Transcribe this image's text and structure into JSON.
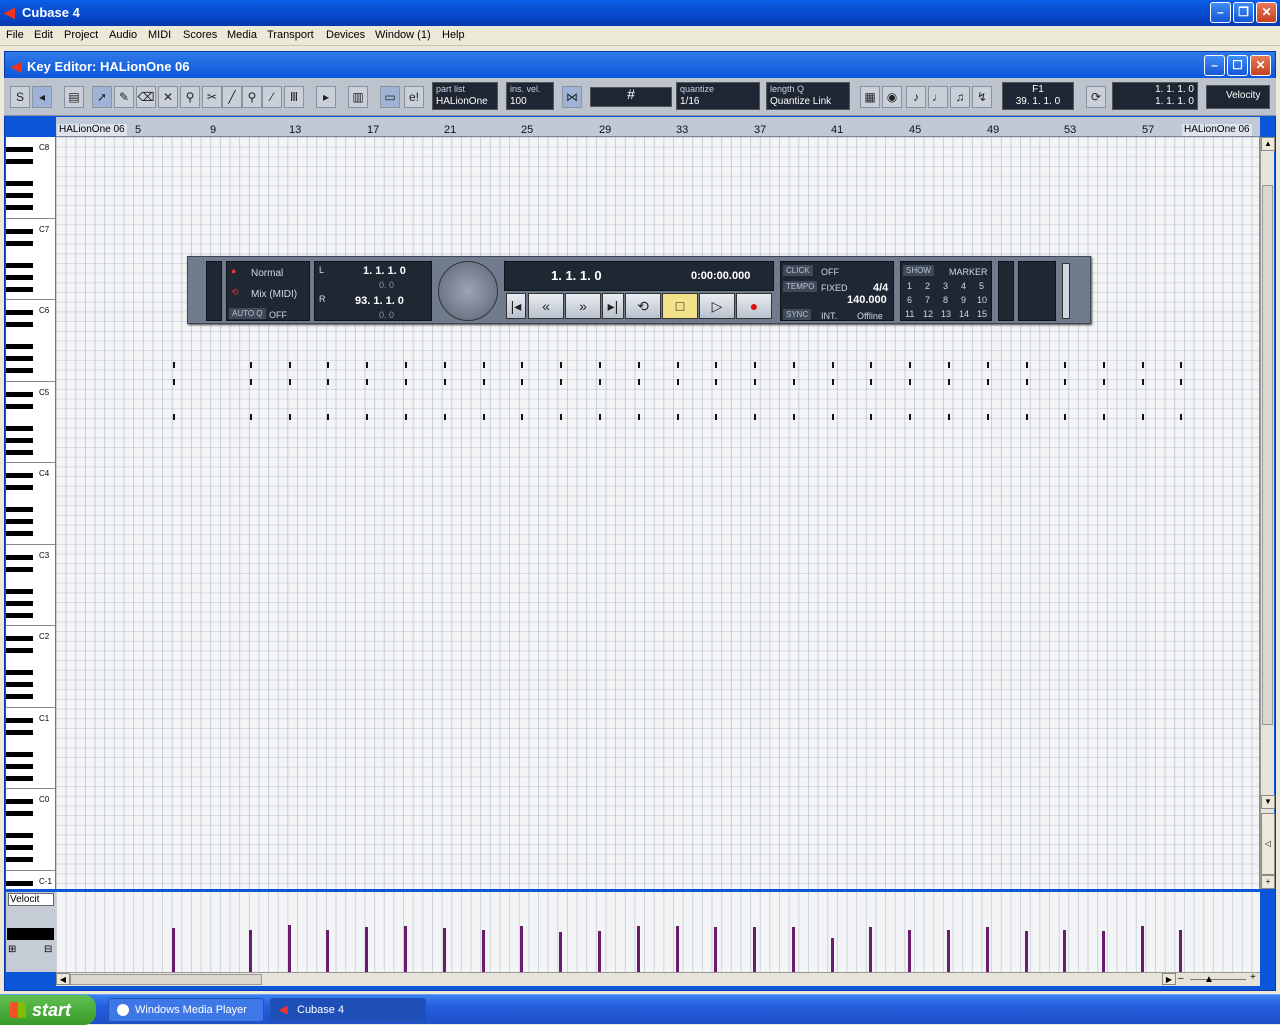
{
  "app": {
    "title": "Cubase 4"
  },
  "menu": [
    "File",
    "Edit",
    "Project",
    "Audio",
    "MIDI",
    "Scores",
    "Media",
    "Transport",
    "Devices",
    "Window (1)",
    "Help"
  ],
  "editor": {
    "title": "Key Editor: HALionOne 06"
  },
  "toolbar": {
    "part_list_label": "part list",
    "part_list_value": "HALionOne",
    "ins_vel_label": "ins. vel.",
    "ins_vel_value": "100",
    "quantize_label": "quantize",
    "quantize_value": "1/16",
    "length_label": "length Q",
    "length_value": "Quantize Link",
    "mouse_note": "F1",
    "mouse_pos": "39. 1. 1.  0",
    "pos_a": "1. 1. 1.  0",
    "pos_b": "1. 1. 1.  0",
    "lane_type": "Velocity"
  },
  "ruler": {
    "labels": [
      "5",
      "9",
      "13",
      "17",
      "21",
      "25",
      "29",
      "33",
      "37",
      "41",
      "45",
      "49",
      "53",
      "57"
    ],
    "part_start": "HALionOne 06",
    "part_end": "HALionOne 06"
  },
  "keyboard": {
    "octaves": [
      "C8",
      "C7",
      "C6",
      "C5",
      "C4",
      "C3",
      "C2",
      "C1",
      "C0",
      "C-1"
    ]
  },
  "transport": {
    "mode": "Normal",
    "mix": "Mix (MIDI)",
    "autoq": "AUTO Q",
    "autoq_val": "OFF",
    "left_loc": "1. 1. 1.  0",
    "left_sub": "0.   0",
    "right_loc": "93. 1. 1.  0",
    "right_sub": "0.   0",
    "position": "1. 1. 1.  0",
    "time": "0:00:00.000",
    "click": "CLICK",
    "click_val": "OFF",
    "tempo": "TEMPO",
    "tempo_mode": "FIXED",
    "signature": "4/4",
    "tempo_val": "140.000",
    "sync": "SYNC",
    "sync_mode": "INT.",
    "sync_status": "Offline",
    "show": "SHOW",
    "marker": "MARKER",
    "markers": [
      "1",
      "2",
      "3",
      "4",
      "5",
      "6",
      "7",
      "8",
      "9",
      "10",
      "11",
      "12",
      "13",
      "14",
      "15"
    ]
  },
  "velocity_lane": {
    "label": "Velocit"
  },
  "notes": {
    "columns": [
      173,
      250,
      289,
      327,
      366,
      405,
      444,
      483,
      521,
      560,
      599,
      638,
      677,
      715,
      754,
      793,
      832,
      870,
      909,
      948,
      987,
      1026,
      1064,
      1103,
      1142,
      1180
    ],
    "velocities": [
      0.55,
      0.52,
      0.59,
      0.53,
      0.56,
      0.58,
      0.55,
      0.52,
      0.57,
      0.5,
      0.51,
      0.58,
      0.57,
      0.56,
      0.56,
      0.56,
      0.43,
      0.56,
      0.53,
      0.52,
      0.56,
      0.51,
      0.52,
      0.51,
      0.57,
      0.53
    ]
  },
  "taskbar": {
    "start": "start",
    "items": [
      "Windows Media Player",
      "Cubase 4"
    ]
  }
}
